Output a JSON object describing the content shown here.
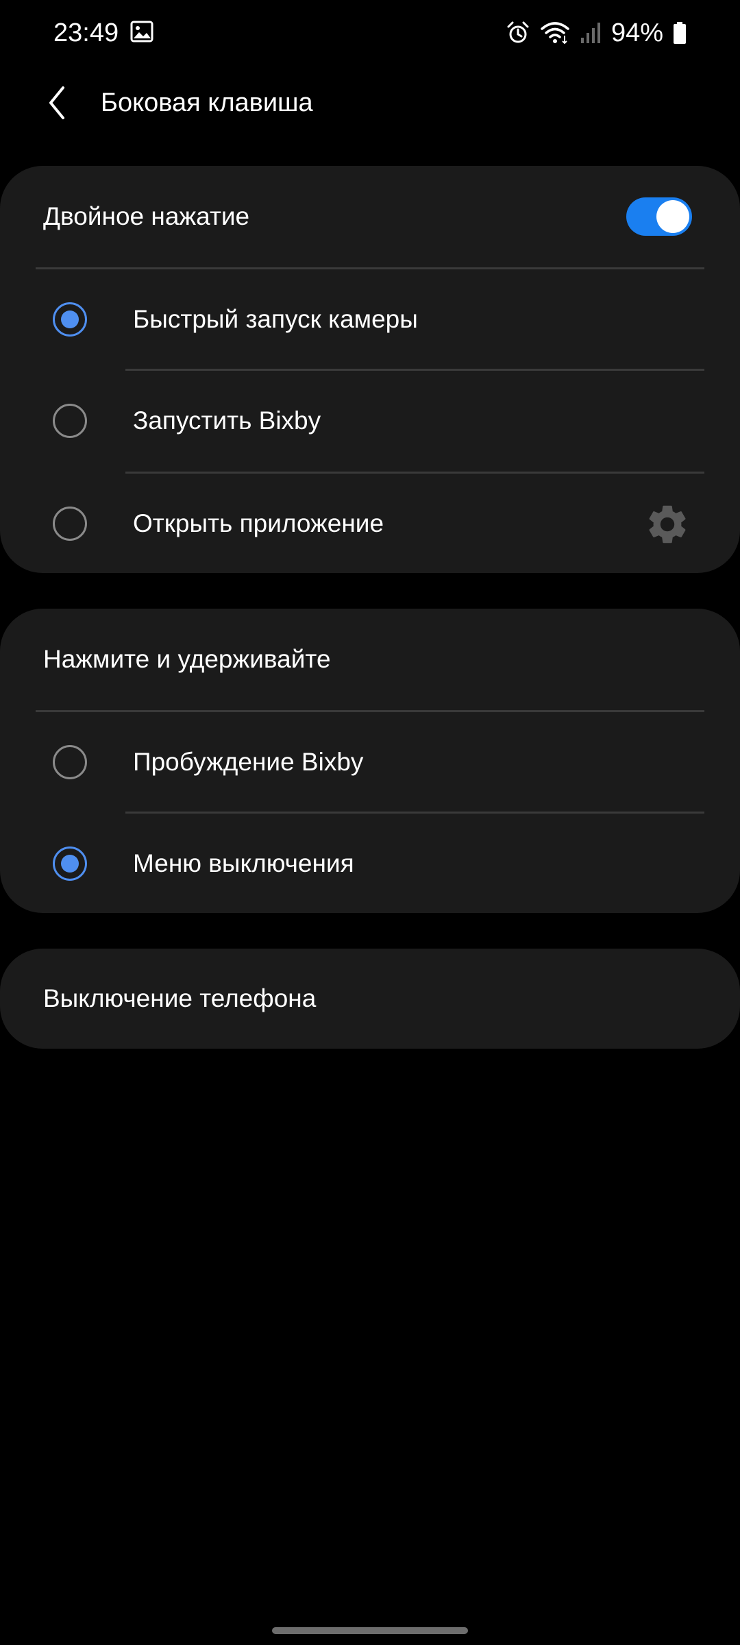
{
  "status_bar": {
    "time": "23:49",
    "battery_text": "94%",
    "icons": [
      "gallery-icon",
      "alarm-icon",
      "wifi-icon",
      "signal-icon",
      "battery-icon"
    ]
  },
  "header": {
    "title": "Боковая клавиша",
    "back_icon": "chevron-left-icon"
  },
  "double_press": {
    "label": "Двойное нажатие",
    "toggle_on": true,
    "options": [
      {
        "label": "Быстрый запуск камеры",
        "selected": true
      },
      {
        "label": "Запустить Bixby",
        "selected": false
      },
      {
        "label": "Открыть приложение",
        "selected": false,
        "has_settings": true
      }
    ]
  },
  "press_and_hold": {
    "label": "Нажмите и удерживайте",
    "options": [
      {
        "label": "Пробуждение Bixby",
        "selected": false
      },
      {
        "label": "Меню выключения",
        "selected": true
      }
    ]
  },
  "power_off": {
    "label": "Выключение телефона"
  },
  "colors": {
    "background": "#000000",
    "card": "#1b1b1b",
    "accent": "#4f8ff0",
    "toggle_on": "#1a7ff0"
  }
}
